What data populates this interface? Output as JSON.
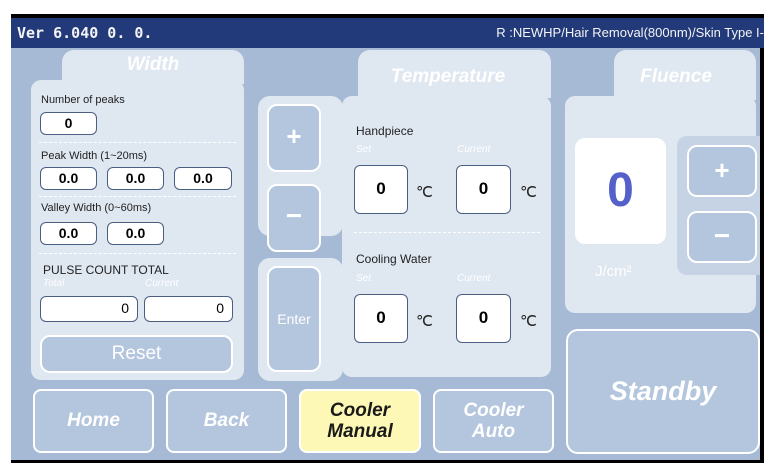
{
  "header": {
    "version": "Ver 6.040 0. 0.",
    "mode": "R :NEWHP/Hair Removal(800nm)/Skin Type I-"
  },
  "width_panel": {
    "title": "Width",
    "peaks_label": "Number of peaks",
    "peaks_value": "0",
    "peak_width_label": "Peak Width (1~20ms)",
    "peak_width_values": [
      "0.0",
      "0.0",
      "0.0"
    ],
    "valley_width_label": "Valley Width (0~60ms)",
    "valley_width_values": [
      "0.0",
      "0.0"
    ],
    "pulse_count_label": "PULSE COUNT TOTAL",
    "total_label": "Total",
    "current_label": "Current",
    "total_value": "0",
    "current_value": "0",
    "reset_label": "Reset"
  },
  "center_buttons": {
    "plus": "+",
    "minus": "−",
    "enter": "Enter"
  },
  "temperature_panel": {
    "title": "Temperature",
    "handpiece_label": "Handpiece",
    "cooling_label": "Cooling Water",
    "set_label": "Set",
    "current_label": "Current",
    "handpiece_set": "0",
    "handpiece_current": "0",
    "cooling_set": "0",
    "cooling_current": "0",
    "unit": "℃"
  },
  "fluence_panel": {
    "title": "Fluence",
    "value": "0",
    "unit": "J/cm²",
    "plus": "+",
    "minus": "−"
  },
  "status": {
    "label": "Standby"
  },
  "nav": {
    "home": "Home",
    "back": "Back",
    "cooler_manual_line1": "Cooler",
    "cooler_manual_line2": "Manual",
    "cooler_auto_line1": "Cooler",
    "cooler_auto_line2": "Auto"
  },
  "colors": {
    "background": "#a6bad5",
    "panel": "#dfe7f1",
    "title_bar": "#223a7a",
    "active_button": "#fdf8b6",
    "fluence_value": "#5560c8"
  }
}
